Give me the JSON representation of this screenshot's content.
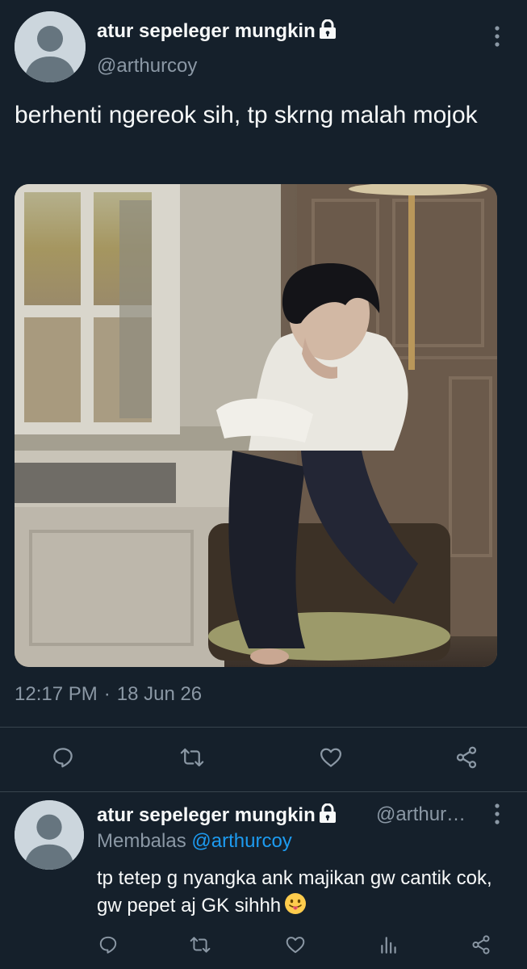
{
  "main_tweet": {
    "author_name": "atur sepeleger mungkin",
    "handle": "@arthurcoy",
    "text": "berhenti ngereok sih, tp skrng malah mojok",
    "time": "12:17 PM",
    "separator": "·",
    "date": "18 Jun 26",
    "icons": [
      "lock-icon",
      "more-icon",
      "reply-icon",
      "retweet-icon",
      "like-icon",
      "share-icon"
    ]
  },
  "reply_tweet": {
    "author_name": "atur sepeleger mungkin",
    "handle": "@arthur…",
    "replying_label": "Membalas",
    "replying_to": "@arthurcoy",
    "text": "tp tetep g nyangka ank majikan gw cantik cok, gw pepet aj GK sihhh",
    "emoji": "😛",
    "icons": [
      "lock-icon",
      "more-icon",
      "reply-icon",
      "retweet-icon",
      "like-icon",
      "views-icon",
      "share-icon"
    ]
  },
  "colors": {
    "background": "#15202b",
    "text_primary": "#f7f9f9",
    "text_secondary": "#8b98a5",
    "link": "#1d9bf0",
    "divider": "#38444d"
  }
}
